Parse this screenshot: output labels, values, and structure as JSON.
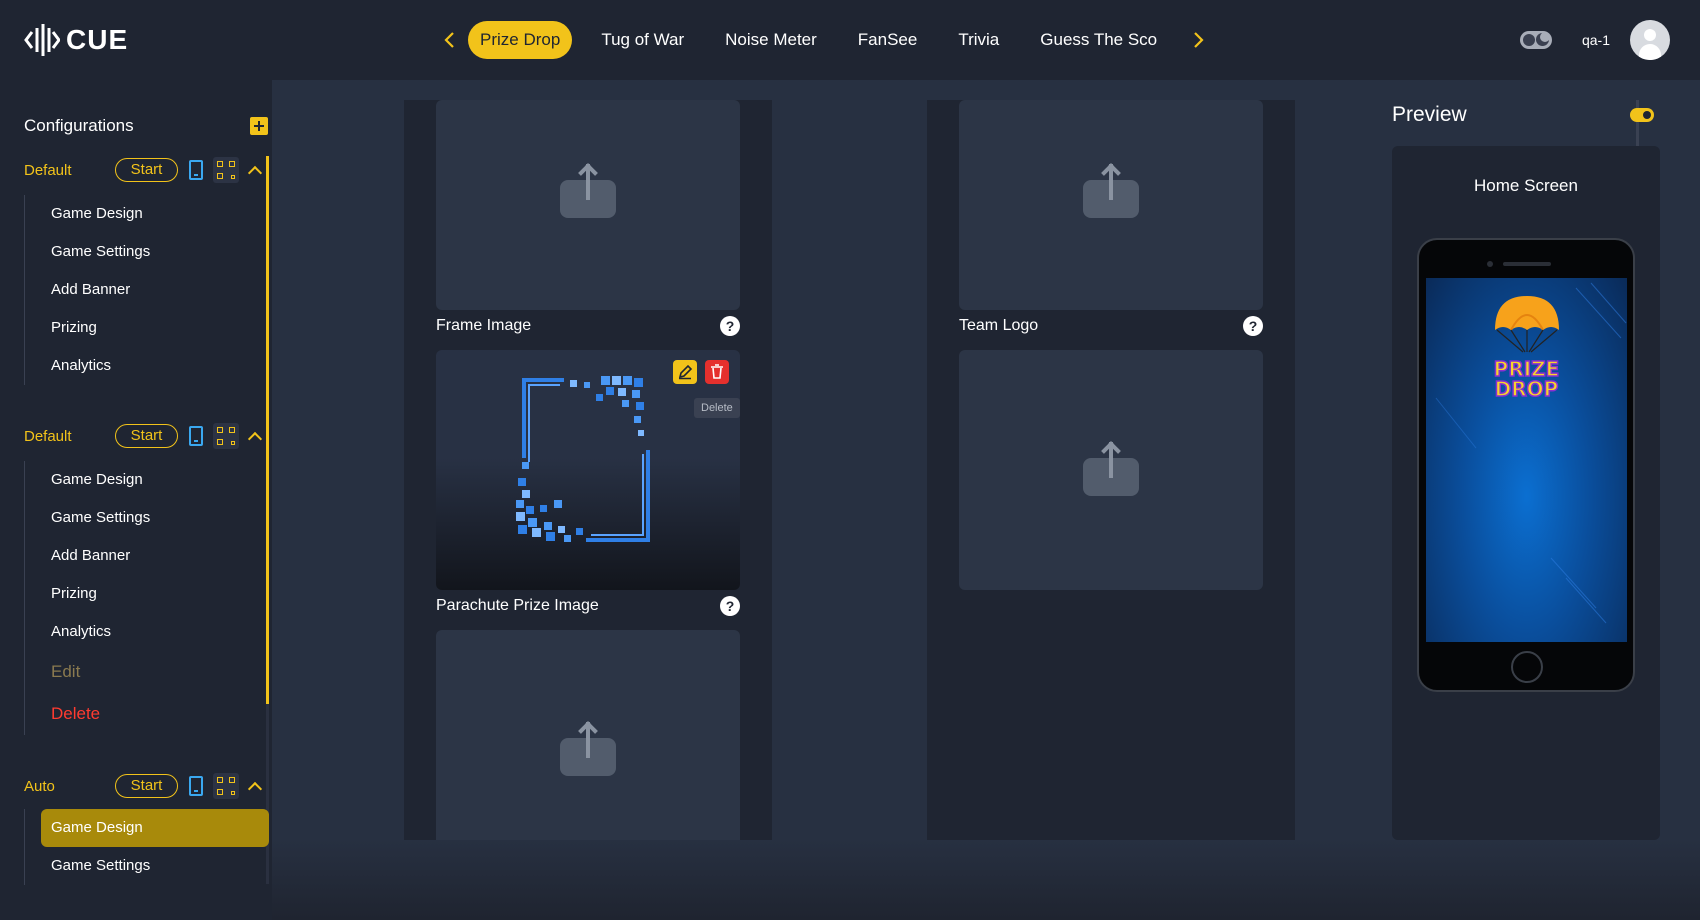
{
  "app": {
    "logo_text": "CUE"
  },
  "nav": {
    "tabs": [
      {
        "label": "Prize Drop",
        "active": true
      },
      {
        "label": "Tug of War",
        "active": false
      },
      {
        "label": "Noise Meter",
        "active": false
      },
      {
        "label": "FanSee",
        "active": false
      },
      {
        "label": "Trivia",
        "active": false
      },
      {
        "label": "Guess The Sco",
        "active": false
      }
    ]
  },
  "user": {
    "name": "qa-1"
  },
  "sidebar": {
    "title": "Configurations",
    "configs": [
      {
        "name": "Default",
        "start_label": "Start",
        "items": [
          "Game Design",
          "Game Settings",
          "Add Banner",
          "Prizing",
          "Analytics"
        ]
      },
      {
        "name": "Default",
        "start_label": "Start",
        "items": [
          "Game Design",
          "Game Settings",
          "Add Banner",
          "Prizing",
          "Analytics"
        ],
        "edit_label": "Edit",
        "delete_label": "Delete"
      },
      {
        "name": "Auto",
        "start_label": "Start",
        "items": [
          "Game Design",
          "Game Settings"
        ],
        "active_item": "Game Design"
      }
    ]
  },
  "main": {
    "fields": {
      "frame_image": "Frame Image",
      "parachute_prize_image": "Parachute Prize Image",
      "team_logo": "Team Logo",
      "help_glyph": "?"
    },
    "tooltip_delete": "Delete"
  },
  "preview": {
    "title": "Preview",
    "screen_label": "Home Screen",
    "game_logo_line1": "PRIZE",
    "game_logo_line2": "DROP"
  },
  "colors": {
    "accent": "#f2c31a",
    "danger": "#e5302d",
    "background": "#1f2532",
    "panel": "#273041"
  }
}
